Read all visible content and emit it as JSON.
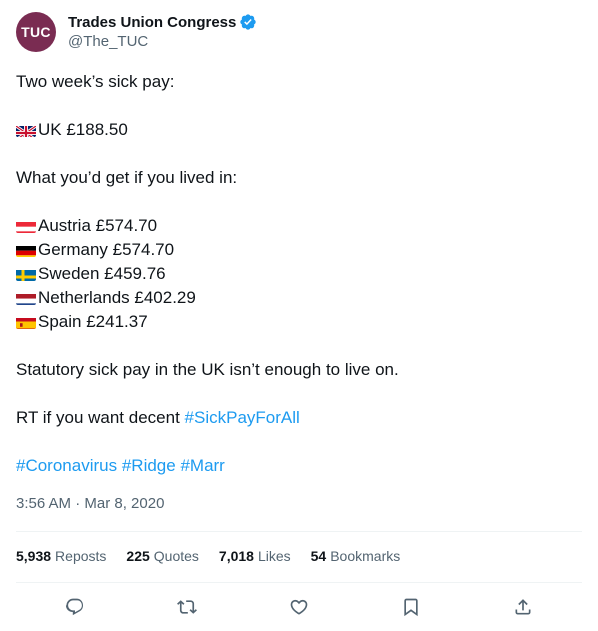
{
  "author": {
    "avatar_text": "TUC",
    "display_name": "Trades Union Congress",
    "handle": "@The_TUC",
    "verified": true
  },
  "tweet": {
    "line1": "Two week’s sick pay:",
    "uk": "UK £188.50",
    "line3": "What you’d get if you lived in:",
    "countries": [
      {
        "flag": "austria-flag-icon",
        "text": "Austria £574.70"
      },
      {
        "flag": "germany-flag-icon",
        "text": "Germany £574.70"
      },
      {
        "flag": "sweden-flag-icon",
        "text": "Sweden £459.76"
      },
      {
        "flag": "netherlands-flag-icon",
        "text": "Netherlands £402.29"
      },
      {
        "flag": "spain-flag-icon",
        "text": "Spain £241.37"
      }
    ],
    "statement": "Statutory sick pay in the UK isn’t enough to live on.",
    "rt_prefix": "RT if you want decent ",
    "rt_hashtag": "#SickPayForAll",
    "hashtags": [
      "#Coronavirus",
      "#Ridge",
      "#Marr"
    ]
  },
  "timestamp": "3:56 AM · Mar 8, 2020",
  "stats": {
    "reposts": {
      "count": "5,938",
      "label": "Reposts"
    },
    "quotes": {
      "count": "225",
      "label": "Quotes"
    },
    "likes": {
      "count": "7,018",
      "label": "Likes"
    },
    "bookmarks": {
      "count": "54",
      "label": "Bookmarks"
    }
  },
  "actions": [
    "reply-icon",
    "repost-icon",
    "like-icon",
    "bookmark-icon",
    "share-icon"
  ],
  "colors": {
    "link": "#1d9bf0",
    "secondary_text": "#536471",
    "avatar_bg": "#7a2c52",
    "divider": "#eff3f4"
  }
}
